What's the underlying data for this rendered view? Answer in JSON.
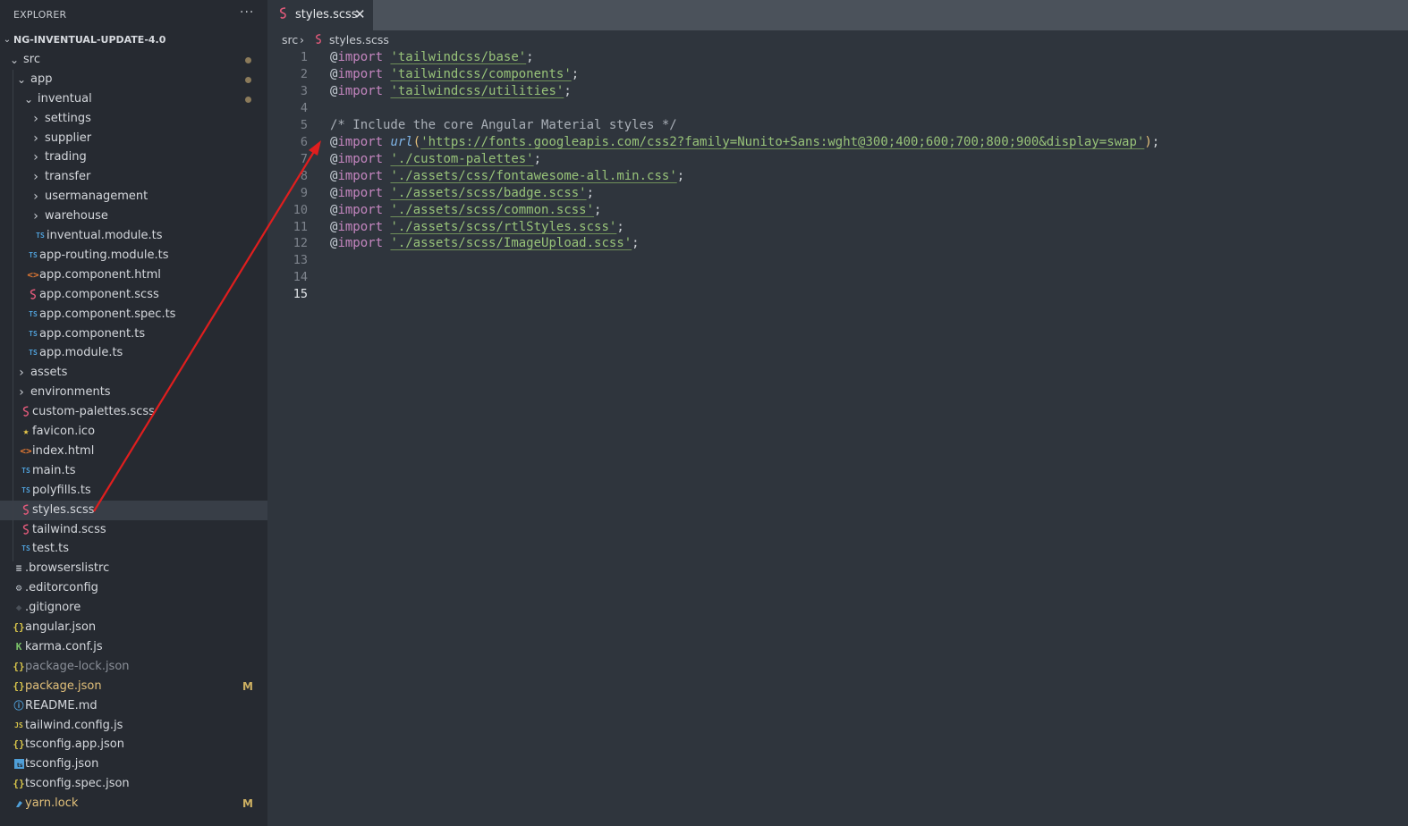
{
  "explorer": {
    "title": "EXPLORER",
    "more": "···",
    "root": "NG-INVENTUAL-UPDATE-4.0",
    "items": [
      {
        "label": "src",
        "kind": "folder",
        "icon": ""
      },
      {
        "label": "app",
        "kind": "folder",
        "icon": ""
      },
      {
        "label": "inventual",
        "kind": "folder",
        "icon": ""
      },
      {
        "label": "settings",
        "kind": "folder",
        "icon": ""
      },
      {
        "label": "supplier",
        "kind": "folder",
        "icon": ""
      },
      {
        "label": "trading",
        "kind": "folder",
        "icon": ""
      },
      {
        "label": "transfer",
        "kind": "folder",
        "icon": ""
      },
      {
        "label": "usermanagement",
        "kind": "folder",
        "icon": ""
      },
      {
        "label": "warehouse",
        "kind": "folder",
        "icon": ""
      },
      {
        "label": "inventual.module.ts",
        "kind": "file",
        "icon": "TS"
      },
      {
        "label": "app-routing.module.ts",
        "kind": "file",
        "icon": "TS"
      },
      {
        "label": "app.component.html",
        "kind": "file",
        "icon": "<>"
      },
      {
        "label": "app.component.scss",
        "kind": "file",
        "icon": "sass"
      },
      {
        "label": "app.component.spec.ts",
        "kind": "file",
        "icon": "TS"
      },
      {
        "label": "app.component.ts",
        "kind": "file",
        "icon": "TS"
      },
      {
        "label": "app.module.ts",
        "kind": "file",
        "icon": "TS"
      },
      {
        "label": "assets",
        "kind": "folder",
        "icon": ""
      },
      {
        "label": "environments",
        "kind": "folder",
        "icon": ""
      },
      {
        "label": "custom-palettes.scss",
        "kind": "file",
        "icon": "sass"
      },
      {
        "label": "favicon.ico",
        "kind": "file",
        "icon": "★"
      },
      {
        "label": "index.html",
        "kind": "file",
        "icon": "<>"
      },
      {
        "label": "main.ts",
        "kind": "file",
        "icon": "TS"
      },
      {
        "label": "polyfills.ts",
        "kind": "file",
        "icon": "TS"
      },
      {
        "label": "styles.scss",
        "kind": "file",
        "icon": "sass"
      },
      {
        "label": "tailwind.scss",
        "kind": "file",
        "icon": "sass"
      },
      {
        "label": "test.ts",
        "kind": "file",
        "icon": "TS"
      },
      {
        "label": ".browserslistrc",
        "kind": "file",
        "icon": "≡"
      },
      {
        "label": ".editorconfig",
        "kind": "file",
        "icon": "⚙"
      },
      {
        "label": ".gitignore",
        "kind": "file",
        "icon": "◆"
      },
      {
        "label": "angular.json",
        "kind": "file",
        "icon": "{}"
      },
      {
        "label": "karma.conf.js",
        "kind": "file",
        "icon": "K"
      },
      {
        "label": "package-lock.json",
        "kind": "file",
        "icon": "{}"
      },
      {
        "label": "package.json",
        "kind": "file",
        "icon": "{}",
        "badge": "M"
      },
      {
        "label": "README.md",
        "kind": "file",
        "icon": "ⓘ"
      },
      {
        "label": "tailwind.config.js",
        "kind": "file",
        "icon": "JS"
      },
      {
        "label": "tsconfig.app.json",
        "kind": "file",
        "icon": "{}"
      },
      {
        "label": "tsconfig.json",
        "kind": "file",
        "icon": "ts"
      },
      {
        "label": "tsconfig.spec.json",
        "kind": "file",
        "icon": "{}"
      },
      {
        "label": "yarn.lock",
        "kind": "file",
        "icon": "yarn",
        "badge": "M"
      }
    ]
  },
  "tab": {
    "label": "styles.scss",
    "close": "✕"
  },
  "breadcrumb": {
    "folder": "src",
    "separator": "›",
    "file": "styles.scss"
  },
  "code": {
    "line_numbers": [
      "1",
      "2",
      "3",
      "4",
      "5",
      "6",
      "7",
      "8",
      "9",
      "10",
      "11",
      "12",
      "13",
      "14",
      "15"
    ],
    "lines": [
      {
        "at": "@",
        "kw": "import",
        "str": "'tailwindcss/base'",
        "end": ";"
      },
      {
        "at": "@",
        "kw": "import",
        "str": "'tailwindcss/components'",
        "end": ";"
      },
      {
        "at": "@",
        "kw": "import",
        "str": "'tailwindcss/utilities'",
        "end": ";"
      },
      {},
      {
        "comment": "/* Include the core Angular Material styles */"
      },
      {
        "at": "@",
        "kw": "import",
        "fn": "url",
        "open": "(",
        "str": "'https://fonts.googleapis.com/css2?family=Nunito+Sans:wght@300;400;600;700;800;900&display=swap'",
        "close": ")",
        "end": ";"
      },
      {
        "at": "@",
        "kw": "import",
        "str": "'./custom-palettes'",
        "end": ";"
      },
      {
        "at": "@",
        "kw": "import",
        "str": "'./assets/css/fontawesome-all.min.css'",
        "end": ";"
      },
      {
        "at": "@",
        "kw": "import",
        "str": "'./assets/scss/badge.scss'",
        "end": ";"
      },
      {
        "at": "@",
        "kw": "import",
        "str": "'./assets/scss/common.scss'",
        "end": ";"
      },
      {
        "at": "@",
        "kw": "import",
        "str": "'./assets/scss/rtlStyles.scss'",
        "end": ";"
      },
      {
        "at": "@",
        "kw": "import",
        "str": "'./assets/scss/ImageUpload.scss'",
        "end": ";"
      },
      {},
      {},
      {}
    ]
  },
  "colors": {
    "ts": "#4f9fd8",
    "html": "#e37933",
    "sass": "#e05a7a",
    "json": "#d7c44a",
    "annotation": "#e01e1e"
  }
}
